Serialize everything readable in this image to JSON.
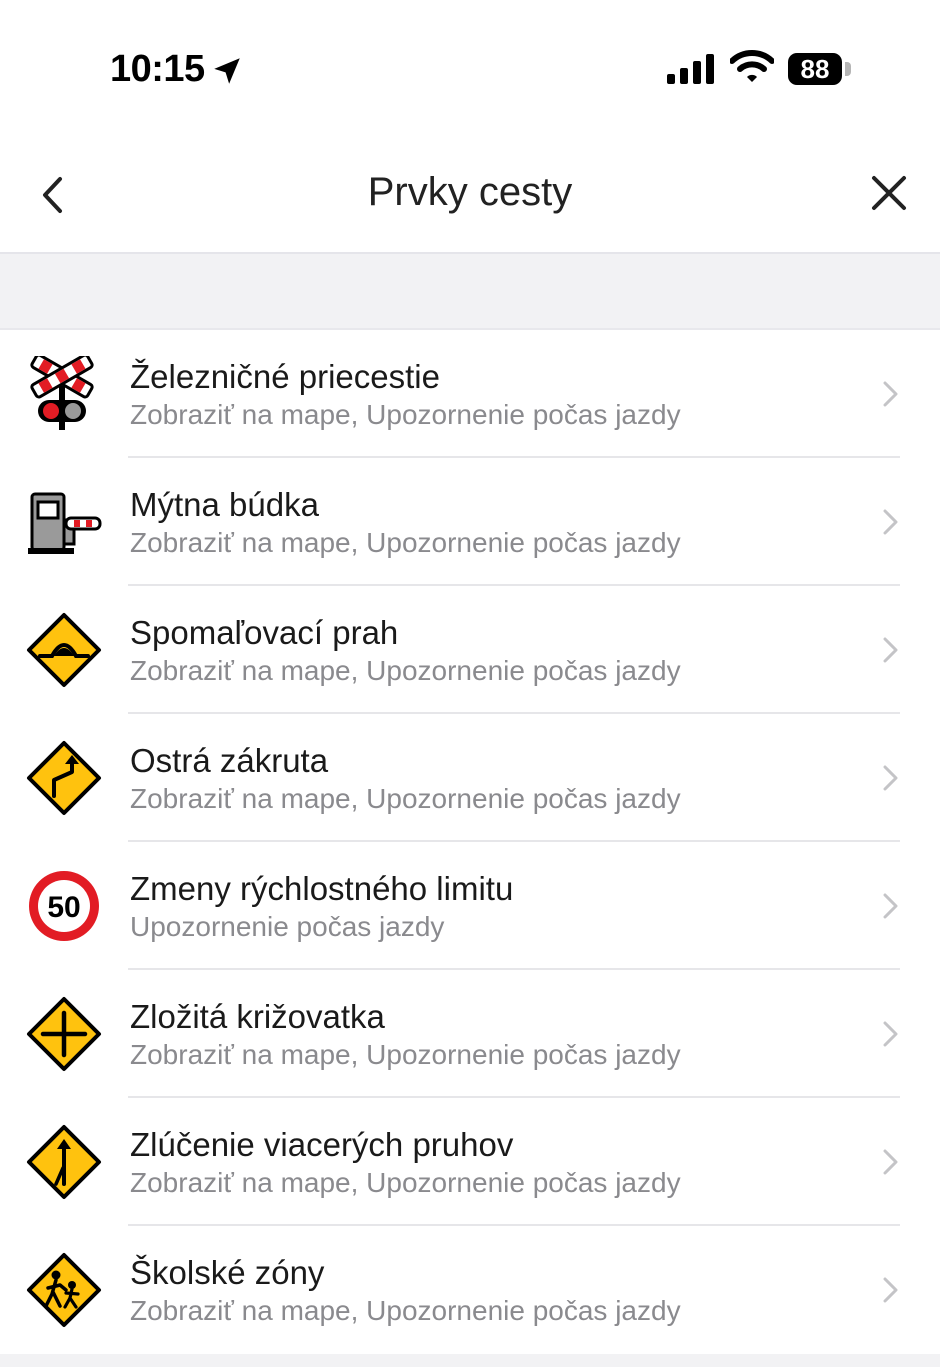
{
  "status_bar": {
    "time": "10:15",
    "battery": "88"
  },
  "header": {
    "title": "Prvky cesty"
  },
  "items": [
    {
      "icon": "railroad-crossing-icon",
      "title": "Železničné priecestie",
      "subtitle": "Zobraziť na mape, Upozornenie počas jazdy"
    },
    {
      "icon": "toll-booth-icon",
      "title": "Mýtna búdka",
      "subtitle": "Zobraziť na mape, Upozornenie počas jazdy"
    },
    {
      "icon": "speed-bump-icon",
      "title": "Spomaľovací prah",
      "subtitle": "Zobraziť na mape, Upozornenie počas jazdy"
    },
    {
      "icon": "sharp-curve-icon",
      "title": "Ostrá zákruta",
      "subtitle": "Zobraziť na mape, Upozornenie počas jazdy"
    },
    {
      "icon": "speed-limit-icon",
      "title": "Zmeny rýchlostného limitu",
      "subtitle": "Upozornenie počas jazdy",
      "badge": "50"
    },
    {
      "icon": "intersection-icon",
      "title": "Zložitá križovatka",
      "subtitle": "Zobraziť na mape, Upozornenie počas jazdy"
    },
    {
      "icon": "lane-merge-icon",
      "title": "Zlúčenie viacerých pruhov",
      "subtitle": "Zobraziť na mape, Upozornenie počas jazdy"
    },
    {
      "icon": "school-zone-icon",
      "title": "Školské zóny",
      "subtitle": "Zobraziť na mape, Upozornenie počas jazdy"
    }
  ],
  "colors": {
    "warning_yellow": "#FFC20E",
    "stop_red": "#E21C24",
    "subtitle_gray": "#8A8A8E",
    "separator": "#E6E6E9"
  }
}
